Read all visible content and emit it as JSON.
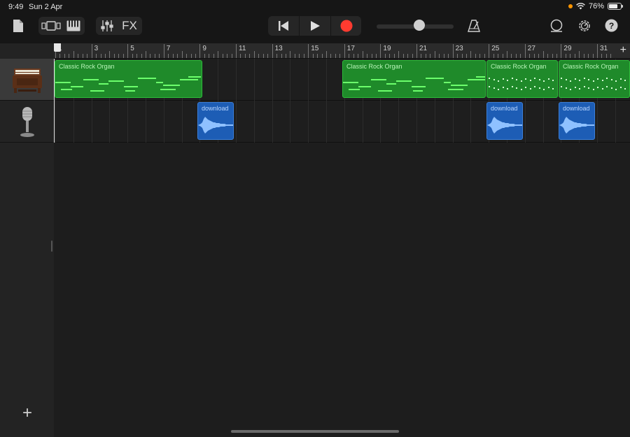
{
  "status": {
    "time": "9:49",
    "date": "Sun 2 Apr",
    "battery": "76%"
  },
  "toolbar": {
    "my_songs": "document-icon",
    "view_toggle": "tracks-view-icon",
    "keyboard": "keyboard-icon",
    "mixer": "mixer-sliders-icon",
    "fx_label": "FX",
    "rewind": "skip-back-icon",
    "play": "play-icon",
    "record": "record-icon",
    "volume_level": 0.55,
    "metronome": "metronome-icon",
    "loop": "loop-icon",
    "settings": "gear-icon",
    "help": "help-icon",
    "record_color": "#ff3b30"
  },
  "ruler": {
    "bars": [
      "1",
      "3",
      "5",
      "7",
      "9",
      "11",
      "13",
      "15",
      "17",
      "19",
      "21",
      "23",
      "25",
      "27",
      "29",
      "31"
    ],
    "add_label": "+"
  },
  "tracks": [
    {
      "name": "organ-track",
      "icon": "organ-icon",
      "selected": true
    },
    {
      "name": "microphone-track",
      "icon": "microphone-icon",
      "selected": false
    }
  ],
  "regions": {
    "midi": [
      {
        "name": "Classic Rock Organ"
      },
      {
        "name": "Classic Rock Organ"
      },
      {
        "name": "Classic Rock Organ"
      },
      {
        "name": "Classic Rock Organ"
      }
    ],
    "audio": [
      {
        "name": "download"
      },
      {
        "name": "download"
      },
      {
        "name": "download"
      }
    ]
  },
  "add_track_label": "+",
  "colors": {
    "midi": "#1f8a2a",
    "audio": "#1d5db5",
    "record": "#ff3b30"
  }
}
